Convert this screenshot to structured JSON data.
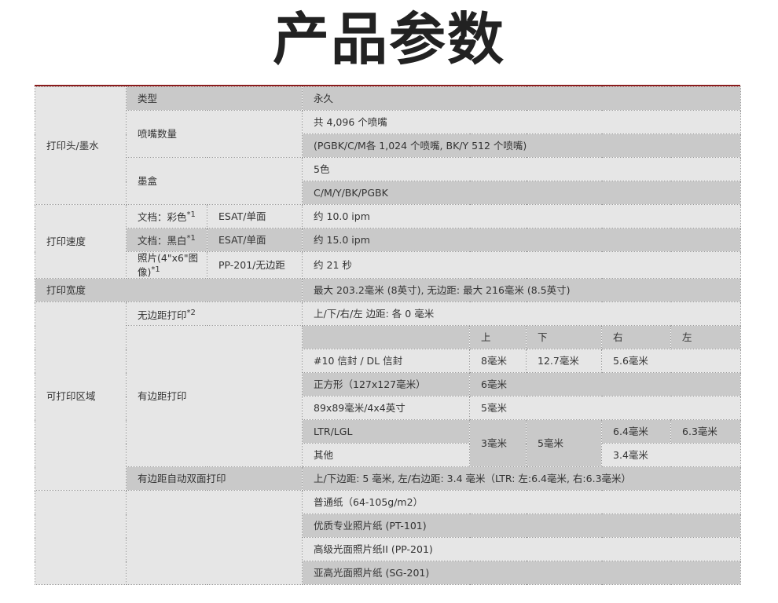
{
  "title": "产品参数",
  "rows": {
    "printhead": {
      "label": "打印头/墨水",
      "type_label": "类型",
      "type_value": "永久",
      "nozzle_label": "喷嘴数量",
      "nozzle_total": "共 4,096 个喷嘴",
      "nozzle_detail": "(PGBK/C/M各 1,024 个喷嘴, BK/Y 512 个喷嘴)",
      "cartridge_label": "墨盒",
      "cartridge_count": "5色",
      "cartridge_colors": "C/M/Y/BK/PGBK"
    },
    "speed": {
      "label": "打印速度",
      "color_doc": "文档：彩色",
      "color_mark": "*1",
      "color_mode": "ESAT/单面",
      "color_value": "约 10.0 ipm",
      "black_doc": "文档：黑白",
      "black_mark": "*1",
      "black_mode": "ESAT/单面",
      "black_value": "约 15.0 ipm",
      "photo_doc": "照片(4\"x6\"图像)",
      "photo_mark": "*1",
      "photo_mode": "PP-201/无边距",
      "photo_value": "约 21 秒"
    },
    "width": {
      "label": "打印宽度",
      "value": "最大 203.2毫米 (8英寸), 无边距: 最大 216毫米 (8.5英寸)"
    },
    "area": {
      "label": "可打印区域",
      "borderless_label": "无边距打印",
      "borderless_mark": "*2",
      "borderless_value": "上/下/右/左 边距: 各 0 毫米",
      "bordered_label": "有边距打印",
      "head_top": "上",
      "head_bottom": "下",
      "head_right": "右",
      "head_left": "左",
      "env_label": "#10 信封 / DL 信封",
      "env_top": "8毫米",
      "env_bottom": "12.7毫米",
      "env_right": "5.6毫米",
      "sq_label": "正方形（127x127毫米）",
      "sq_value": "6毫米",
      "s89_label": "89x89毫米/4x4英寸",
      "s89_value": "5毫米",
      "ltr_label": "LTR/LGL",
      "other_label": "其他",
      "ltr_top": "3毫米",
      "ltr_bottom": "5毫米",
      "ltr_right": "6.4毫米",
      "ltr_left": "6.3毫米",
      "other_right": "3.4毫米",
      "duplex_label": "有边距自动双面打印",
      "duplex_value": "上/下边距: 5 毫米, 左/右边距: 3.4 毫米（LTR: 左:6.4毫米, 右:6.3毫米）"
    },
    "media": {
      "plain": "普通纸（64-105g/m2）",
      "pt101": "优质专业照片纸 (PT-101)",
      "pp201": "高级光面照片纸II (PP-201)",
      "sg201": "亚高光面照片纸 (SG-201)"
    }
  }
}
